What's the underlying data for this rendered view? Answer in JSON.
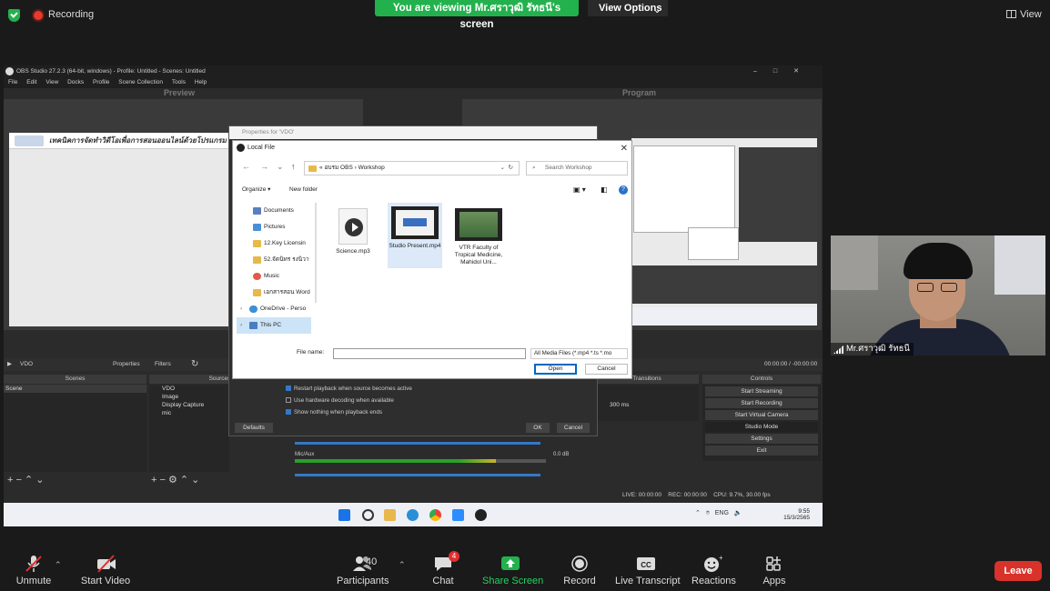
{
  "zoom_top": {
    "recording_label": "Recording",
    "viewing_banner": "You are viewing Mr.ศราวุฒิ รัทธนี's screen",
    "view_options_label": "View Options",
    "view_label": "View"
  },
  "obs": {
    "window_title": "OBS Studio 27.2.3 (64-bit, windows) - Profile: Untitled - Scenes: Untitled",
    "menu": [
      "File",
      "Edit",
      "View",
      "Docks",
      "Profile",
      "Scene Collection",
      "Tools",
      "Help"
    ],
    "preview_label": "Preview",
    "program_label": "Program",
    "preview_banner_text": "เทคนิคการจัดทำวิดีโอเพื่อการสอนออนไลน์ด้วยโปรแกรม",
    "source_toolbar": {
      "source_name": "VDO",
      "properties_label": "Properties",
      "filters_label": "Filters",
      "time_readout": "00:00:00 / -00:00:00"
    },
    "docks": {
      "scenes": "Scenes",
      "sources": "Sources",
      "transitions": "Transitions",
      "controls": "Controls"
    },
    "scenes": [
      "Scene"
    ],
    "sources": [
      "VDO",
      "Image",
      "Display Capture",
      "mic"
    ],
    "transition_duration": "300 ms",
    "controls": [
      "Start Streaming",
      "Start Recording",
      "Start Virtual Camera",
      "Studio Mode",
      "Settings",
      "Exit"
    ],
    "mixer": {
      "label": "Mic/Aux",
      "level": "0.0 dB"
    },
    "status": {
      "live": "LIVE: 00:00:00",
      "rec": "REC: 00:00:00",
      "cpu": "CPU: 9.7%, 30.00 fps"
    }
  },
  "properties_dialog": {
    "title": "Properties for 'VDO'",
    "options": [
      {
        "label": "Restart playback when source becomes active",
        "checked": true
      },
      {
        "label": "Use hardware decoding when available",
        "checked": false
      },
      {
        "label": "Show nothing when playback ends",
        "checked": true
      }
    ],
    "defaults_label": "Defaults",
    "ok_label": "OK",
    "cancel_label": "Cancel"
  },
  "local_file_dialog": {
    "title": "Local File",
    "breadcrumb": [
      "«",
      "อบรม OBS",
      "›",
      "Workshop"
    ],
    "search_placeholder": "Search Workshop",
    "organize_label": "Organize ▾",
    "new_folder_label": "New folder",
    "nav_items": [
      {
        "label": "Documents",
        "color": "#5a7fbf"
      },
      {
        "label": "Pictures",
        "color": "#4a90d9"
      },
      {
        "label": "12.Key Licensin",
        "color": "#e8b84a"
      },
      {
        "label": "52.จัดนิทร รงนิวา",
        "color": "#e8b84a"
      },
      {
        "label": "Music",
        "color": "#e05a4a"
      },
      {
        "label": "เอกสารสอน Word",
        "color": "#e8b84a"
      },
      {
        "label": "OneDrive - Perso",
        "color": "#3b8fd9"
      },
      {
        "label": "This PC",
        "color": "#4a7fbf"
      }
    ],
    "files": [
      {
        "name": "Science.mp3",
        "kind": "audio"
      },
      {
        "name": "Studio Present.mp4",
        "kind": "video",
        "selected": true
      },
      {
        "name": "VTR Faculty of Tropical Medicine, Mahidol Uni...",
        "kind": "video"
      }
    ],
    "file_name_label": "File name:",
    "file_name_value": "",
    "filter_label": "All Media Files (*.mp4 *.ts *.mo",
    "open_label": "Open",
    "cancel_label": "Cancel"
  },
  "taskbar": {
    "lang": "ENG",
    "time": "9:55",
    "date": "15/3/2565"
  },
  "video_tile": {
    "participant_name": "Mr.ศราวุฒิ รัทธนี"
  },
  "zoom_bottom": {
    "unmute": "Unmute",
    "start_video": "Start Video",
    "participants": "Participants",
    "participant_count": "40",
    "chat": "Chat",
    "chat_badge": "4",
    "share_screen": "Share Screen",
    "record": "Record",
    "live_transcript": "Live Transcript",
    "reactions": "Reactions",
    "apps": "Apps",
    "leave": "Leave"
  },
  "colors": {
    "zoom_green": "#23b14d",
    "leave_red": "#d9322b",
    "obs_bg": "#2b2b2b"
  }
}
